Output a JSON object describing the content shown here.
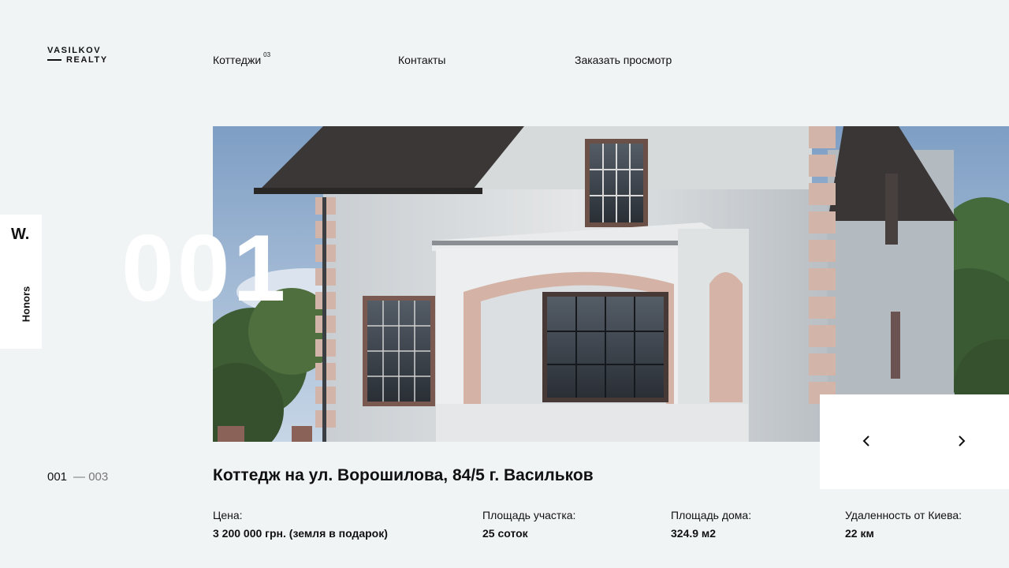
{
  "brand": {
    "line1": "VASILKOV",
    "line2": "REALTY"
  },
  "nav": {
    "items": [
      {
        "label": "Коттеджи",
        "sup": "03"
      },
      {
        "label": "Контакты"
      },
      {
        "label": "Заказать просмотр"
      }
    ]
  },
  "side_tab": {
    "badge": "W.",
    "label": "Honors"
  },
  "slide": {
    "number": "001",
    "current": "001",
    "total": "— 003",
    "title": "Коттедж на ул. Ворошилова, 84/5 г. Васильков"
  },
  "specs": [
    {
      "label": "Цена:",
      "value": "3 200 000 грн. (земля в подарок)"
    },
    {
      "label": "Площадь участка:",
      "value": "25 соток"
    },
    {
      "label": "Площадь дома:",
      "value": "324.9 м2"
    },
    {
      "label": "Удаленность от Киева:",
      "value": "22 км"
    }
  ],
  "icons": {
    "prev": "chevron-left-icon",
    "next": "chevron-right-icon"
  }
}
